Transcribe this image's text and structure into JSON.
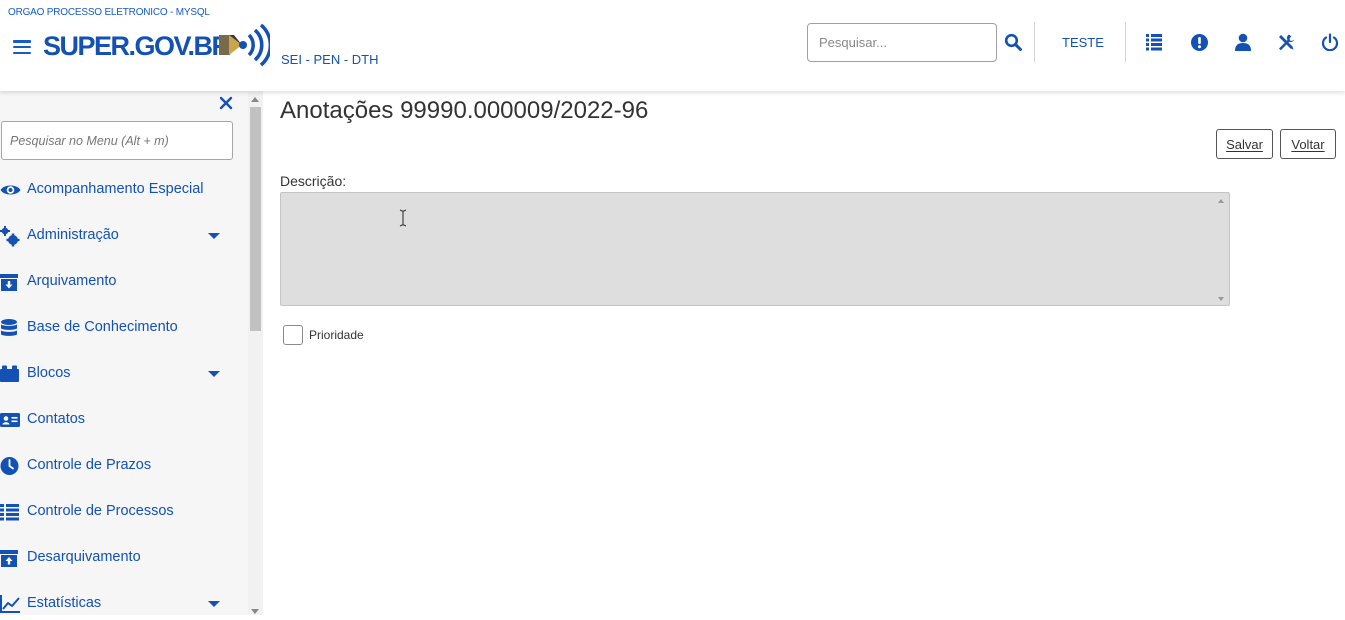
{
  "header": {
    "org_name": "ORGAO PROCESSO ELETRONICO - MYSQL",
    "logo_text": "SUPER.GOV.BR",
    "subtitle": "SEI - PEN - DTH",
    "search_placeholder": "Pesquisar...",
    "unit_name": "TESTE",
    "icons": [
      "menu-icon",
      "search-icon",
      "control-panel-icon",
      "alert-icon",
      "user-icon",
      "tools-icon",
      "power-icon"
    ],
    "brand_color": "#1351b4"
  },
  "sidebar": {
    "search_placeholder": "Pesquisar no Menu (Alt + m)",
    "items": [
      {
        "label": "Acompanhamento Especial",
        "icon": "eye-icon",
        "has_submenu": false
      },
      {
        "label": "Administração",
        "icon": "gears-icon",
        "has_submenu": true
      },
      {
        "label": "Arquivamento",
        "icon": "archive-icon",
        "has_submenu": false
      },
      {
        "label": "Base de Conhecimento",
        "icon": "database-icon",
        "has_submenu": false
      },
      {
        "label": "Blocos",
        "icon": "blocks-icon",
        "has_submenu": true
      },
      {
        "label": "Contatos",
        "icon": "contact-card-icon",
        "has_submenu": false
      },
      {
        "label": "Controle de Prazos",
        "icon": "clock-icon",
        "has_submenu": false
      },
      {
        "label": "Controle de Processos",
        "icon": "list-icon",
        "has_submenu": false
      },
      {
        "label": "Desarquivamento",
        "icon": "unarchive-icon",
        "has_submenu": false
      },
      {
        "label": "Estatísticas",
        "icon": "chart-line-icon",
        "has_submenu": true
      }
    ]
  },
  "main": {
    "title": "Anotações 99990.000009/2022-96",
    "save_label": "Salvar",
    "back_label": "Voltar",
    "description_label": "Descrição:",
    "description_value": "",
    "priority_label": "Prioridade",
    "priority_checked": false
  }
}
